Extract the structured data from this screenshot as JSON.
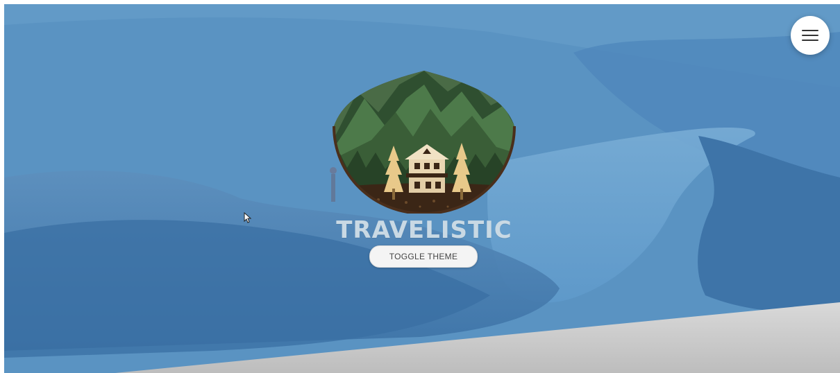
{
  "hero": {
    "brand_name": "TRAVELISTIC",
    "toggle_label": "TOGGLE THEME"
  },
  "nav": {
    "menu_icon": "hamburger-menu-icon"
  },
  "colors": {
    "sky_blue": "#4c89bd",
    "mountain_green": "#3f6b3e",
    "logo_dark": "#4a2f1c",
    "brand_text": "#c9d9e4",
    "footer_gray": "#d2d2d2"
  }
}
